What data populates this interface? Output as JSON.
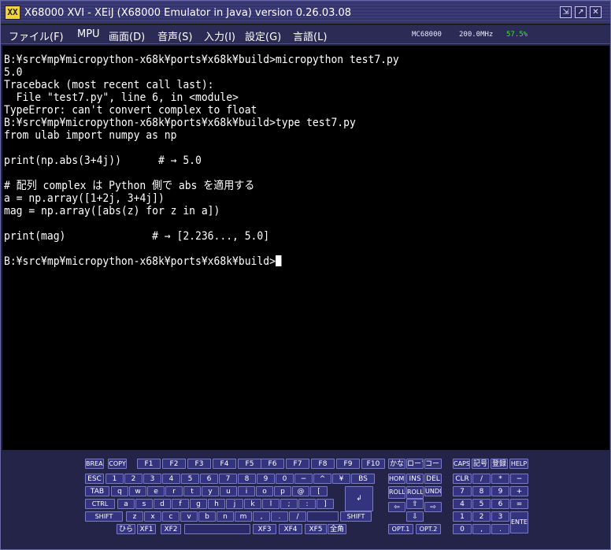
{
  "window": {
    "title": "X68000 XVI - XEiJ (X68000 Emulator in Java) version 0.26.03.08",
    "icon_glyph": "XX",
    "controls": [
      "⇲",
      "↗",
      "✕"
    ]
  },
  "menu": {
    "items": [
      "ファイル(F)",
      "MPU",
      "画面(D)",
      "音声(S)",
      "入力(I)",
      "設定(G)",
      "言語(L)"
    ],
    "status": {
      "cpu": "MC68000",
      "clock": "200.0MHz",
      "load": "57.5%",
      "load_color": "#40e040"
    }
  },
  "terminal": {
    "lines": [
      "B:¥src¥mp¥micropython-x68k¥ports¥x68k¥build>micropython test7.py",
      "5.0",
      "Traceback (most recent call last):",
      "  File \"test7.py\", line 6, in <module>",
      "TypeError: can't convert complex to float",
      "B:¥src¥mp¥micropython-x68k¥ports¥x68k¥build>type test7.py",
      "from ulab import numpy as np",
      "",
      "print(np.abs(3+4j))      # → 5.0",
      "",
      "# 配列 complex は Python 側で abs を適用する",
      "a = np.array([1+2j, 3+4j])",
      "mag = np.array([abs(z) for z in a])",
      "",
      "print(mag)              # → [2.236..., 5.0]",
      "",
      "B:¥src¥mp¥micropython-x68k¥ports¥x68k¥build>"
    ]
  },
  "keyboard": {
    "keys": [
      "BREAK",
      "COPY",
      "F1",
      "F2",
      "F3",
      "F4",
      "F5",
      "F6",
      "F7",
      "F8",
      "F9",
      "F10",
      "かな",
      "ローマ",
      "コード",
      "CAPS",
      "記号",
      "登録",
      "HELP",
      "ESC",
      "1",
      "2",
      "3",
      "4",
      "5",
      "6",
      "7",
      "8",
      "9",
      "0",
      "−",
      "^",
      "¥",
      "BS",
      "HOME",
      "INS",
      "DEL",
      "CLR",
      "/",
      "*",
      "−",
      "TAB",
      "q",
      "w",
      "e",
      "r",
      "t",
      "y",
      "u",
      "i",
      "o",
      "p",
      "@",
      "[",
      "ROLL UP",
      "ROLL DOWN",
      "UNDO",
      "7",
      "8",
      "9",
      "+",
      "CTRL",
      "a",
      "s",
      "d",
      "f",
      "g",
      "h",
      "j",
      "k",
      "l",
      ";",
      ":",
      "]",
      "↲",
      "⇦",
      "⇧",
      "⇨",
      "4",
      "5",
      "6",
      "=",
      "SHIFT",
      "z",
      "x",
      "c",
      "v",
      "b",
      "n",
      "m",
      ",",
      ".",
      "/",
      "",
      "SHIFT",
      "⇩",
      "1",
      "2",
      "3",
      "ENTER",
      "ひら",
      "XF1",
      "XF2",
      "",
      "XF3",
      "XF4",
      "XF5",
      "全角",
      "OPT.1",
      "OPT.2",
      "0",
      ",",
      "."
    ]
  }
}
